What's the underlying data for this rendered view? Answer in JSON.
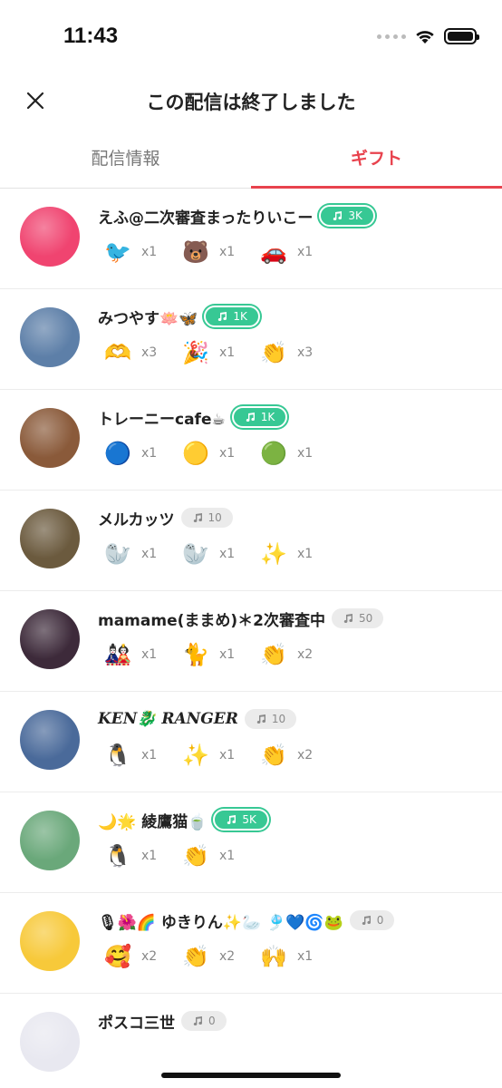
{
  "status": {
    "time": "11:43"
  },
  "header": {
    "title": "この配信は終了しました"
  },
  "tabs": [
    {
      "label": "配信情報",
      "active": false
    },
    {
      "label": "ギフト",
      "active": true
    }
  ],
  "colors": {
    "accent": "#e8424d",
    "badge_green": "#37c894",
    "badge_gray": "#ebebeb"
  },
  "rows": [
    {
      "name": "えふ@二次審査まったりいこー",
      "badge": "3K",
      "badge_style": "green",
      "avatar_color": "#f04470",
      "gifts": [
        {
          "icon": "music-bird-sticker",
          "emoji": "🐦",
          "count": "x1"
        },
        {
          "icon": "bear-clap-sticker",
          "emoji": "🐻",
          "count": "x1"
        },
        {
          "icon": "seal-car-sticker",
          "emoji": "🚗",
          "count": "x1"
        }
      ]
    },
    {
      "name": "みつやす🪷🦋",
      "badge": "1K",
      "badge_style": "green",
      "avatar_color": "#5d7fa8",
      "gifts": [
        {
          "icon": "hand-heart-sticker",
          "emoji": "🫶",
          "count": "x3"
        },
        {
          "icon": "party-popper-icon",
          "emoji": "🎉",
          "count": "x1"
        },
        {
          "icon": "clapping-hands-icon",
          "emoji": "👏",
          "count": "x3"
        }
      ]
    },
    {
      "name": "トレーニーcafe☕",
      "badge": "1K",
      "badge_style": "green",
      "avatar_color": "#8a5a3a",
      "gifts": [
        {
          "icon": "blue-glowstick-icon",
          "emoji": "🔵",
          "count": "x1"
        },
        {
          "icon": "yellow-glowstick-icon",
          "emoji": "🟡",
          "count": "x1"
        },
        {
          "icon": "green-glowstick-icon",
          "emoji": "🟢",
          "count": "x1"
        }
      ]
    },
    {
      "name": "メルカッツ",
      "badge": "10",
      "badge_style": "gray",
      "avatar_color": "#6b5a3e",
      "gifts": [
        {
          "icon": "seal-sticker",
          "emoji": "🦭",
          "count": "x1"
        },
        {
          "icon": "seal-love-sticker",
          "emoji": "🦭",
          "count": "x1"
        },
        {
          "icon": "oshi-arigato-sticker",
          "emoji": "✨",
          "count": "x1"
        }
      ]
    },
    {
      "name": "mamame(ままめ)＊2次審査中",
      "badge": "50",
      "badge_style": "gray",
      "avatar_color": "#3d2a3a",
      "gifts": [
        {
          "icon": "emoi-sticker",
          "emoji": "🎎",
          "count": "x1"
        },
        {
          "icon": "cat-sticker",
          "emoji": "🐈",
          "count": "x1"
        },
        {
          "icon": "clapping-hands-icon",
          "emoji": "👏",
          "count": "x2"
        }
      ]
    },
    {
      "name": "KEN🐉 RANGER",
      "badge": "10",
      "badge_style": "gray",
      "avatar_color": "#4a6a9a",
      "gifts": [
        {
          "icon": "arigato-sticker",
          "emoji": "🐧",
          "count": "x1"
        },
        {
          "icon": "oshi-arigato-sticker",
          "emoji": "✨",
          "count": "x1"
        },
        {
          "icon": "clapping-hands-icon",
          "emoji": "👏",
          "count": "x2"
        }
      ]
    },
    {
      "name": "🌙🌟 綾鷹猫🍵",
      "badge": "5K",
      "badge_style": "green",
      "avatar_color": "#6aa87a",
      "gifts": [
        {
          "icon": "penguin-heart-sticker",
          "emoji": "🐧",
          "count": "x1"
        },
        {
          "icon": "clapping-hands-icon",
          "emoji": "👏",
          "count": "x1"
        }
      ]
    },
    {
      "name": "🎙🌺🌈 ゆきりん✨🦢 🎐💙🌀🐸",
      "badge": "0",
      "badge_style": "gray",
      "avatar_color": "#f7c93a",
      "gifts": [
        {
          "icon": "smiling-face-icon",
          "emoji": "🥰",
          "count": "x2"
        },
        {
          "icon": "clapping-hands-icon",
          "emoji": "👏",
          "count": "x2"
        },
        {
          "icon": "domo-sticker",
          "emoji": "🙌",
          "count": "x1"
        }
      ]
    },
    {
      "name": "ポスコ三世",
      "badge": "0",
      "badge_style": "gray",
      "avatar_color": "#e8e8f0",
      "gifts": []
    }
  ]
}
